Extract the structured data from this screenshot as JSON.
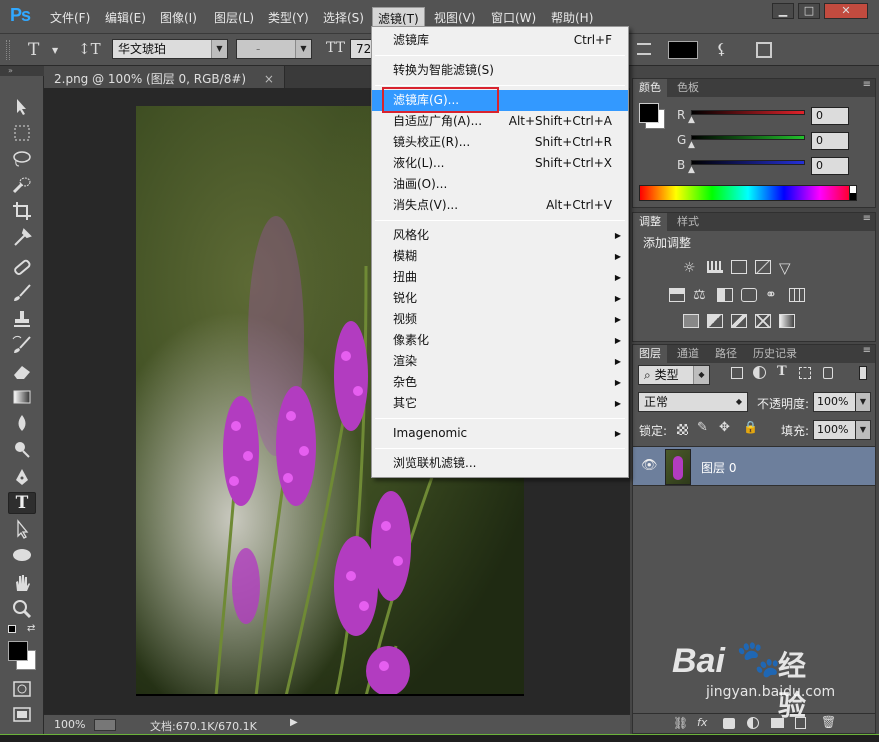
{
  "app_logo": "Ps",
  "menubar": {
    "items": [
      "文件(F)",
      "编辑(E)",
      "图像(I)",
      "图层(L)",
      "类型(Y)",
      "选择(S)",
      "滤镜(T)",
      "视图(V)",
      "窗口(W)",
      "帮助(H)"
    ]
  },
  "window_buttons": {
    "minimize": "▁",
    "maximize": "□",
    "close": "✕"
  },
  "options": {
    "font_family": "华文琥珀",
    "font_style": "-",
    "font_size": "72"
  },
  "document_tab": {
    "title": "2.png @ 100% (图层 0, RGB/8#)",
    "close": "×"
  },
  "status": {
    "zoom": "100%",
    "doc_info": "文档:670.1K/670.1K"
  },
  "panels": {
    "color": {
      "tabs": [
        "颜色",
        "色板"
      ],
      "channels": [
        {
          "label": "R",
          "value": "0",
          "color": "#e0222a"
        },
        {
          "label": "G",
          "value": "0",
          "color": "#22c02c"
        },
        {
          "label": "B",
          "value": "0",
          "color": "#2430d8"
        }
      ]
    },
    "adjustments": {
      "tabs": [
        "调整",
        "样式"
      ],
      "title": "添加调整"
    },
    "layers": {
      "tabs": [
        "图层",
        "通道",
        "路径",
        "历史记录"
      ],
      "filter_kind": "类型",
      "blend_mode": "正常",
      "opacity_label": "不透明度:",
      "opacity_value": "100%",
      "lock_label": "锁定:",
      "fill_label": "填充:",
      "fill_value": "100%",
      "layer_name": "图层 0"
    }
  },
  "filter_menu": {
    "items_top": [
      {
        "label": "滤镜库",
        "shortcut": "Ctrl+F"
      }
    ],
    "convert": "转换为智能滤镜(S)",
    "items_main": [
      {
        "label": "滤镜库(G)...",
        "shortcut": ""
      },
      {
        "label": "自适应广角(A)...",
        "shortcut": "Alt+Shift+Ctrl+A"
      },
      {
        "label": "镜头校正(R)...",
        "shortcut": "Shift+Ctrl+R"
      },
      {
        "label": "液化(L)...",
        "shortcut": "Shift+Ctrl+X"
      },
      {
        "label": "油画(O)...",
        "shortcut": ""
      },
      {
        "label": "消失点(V)...",
        "shortcut": "Alt+Ctrl+V"
      }
    ],
    "submenus": [
      "风格化",
      "模糊",
      "扭曲",
      "锐化",
      "视频",
      "像素化",
      "渲染",
      "杂色",
      "其它"
    ],
    "plugin": "Imagenomic",
    "browse": "浏览联机滤镜..."
  },
  "watermark": {
    "brand": "Bai",
    "brand_cn": "经验",
    "url": "jingyan.baidu.com"
  }
}
